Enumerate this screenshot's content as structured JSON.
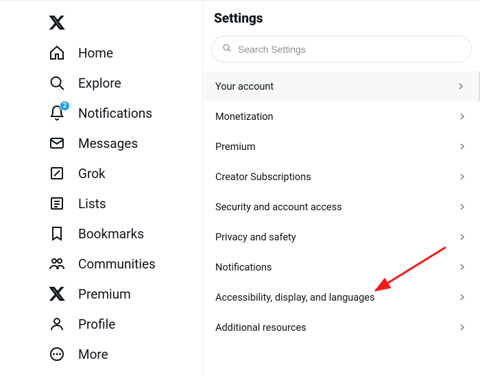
{
  "sidebar": {
    "items": [
      {
        "label": "Home"
      },
      {
        "label": "Explore"
      },
      {
        "label": "Notifications",
        "badge": "2"
      },
      {
        "label": "Messages"
      },
      {
        "label": "Grok"
      },
      {
        "label": "Lists"
      },
      {
        "label": "Bookmarks"
      },
      {
        "label": "Communities"
      },
      {
        "label": "Premium"
      },
      {
        "label": "Profile"
      },
      {
        "label": "More"
      }
    ]
  },
  "header": {
    "title": "Settings"
  },
  "search": {
    "placeholder": "Search Settings"
  },
  "settings": {
    "items": [
      {
        "label": "Your account"
      },
      {
        "label": "Monetization"
      },
      {
        "label": "Premium"
      },
      {
        "label": "Creator Subscriptions"
      },
      {
        "label": "Security and account access"
      },
      {
        "label": "Privacy and safety"
      },
      {
        "label": "Notifications"
      },
      {
        "label": "Accessibility, display, and languages"
      },
      {
        "label": "Additional resources"
      }
    ]
  }
}
